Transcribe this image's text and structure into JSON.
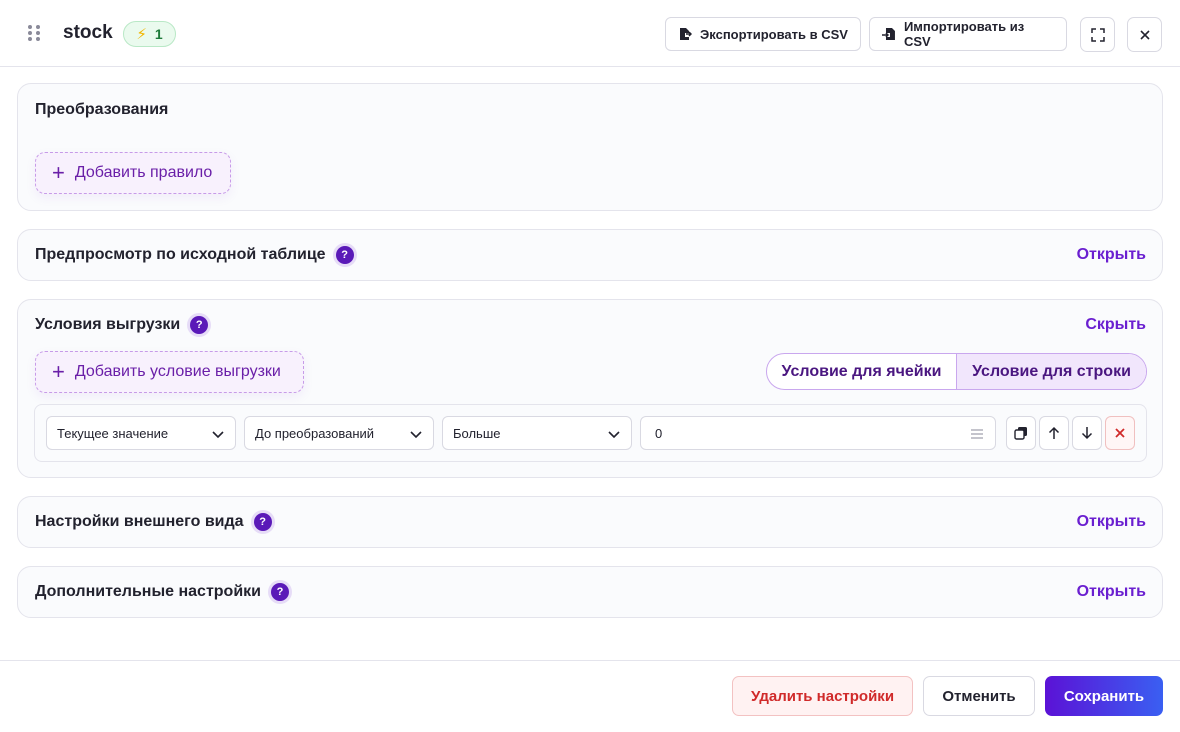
{
  "header": {
    "title": "stock",
    "badge_count": "1",
    "export_label": "Экспортировать в CSV",
    "import_label": "Импортировать из CSV"
  },
  "transformations": {
    "title": "Преобразования",
    "add_rule_label": "Добавить правило"
  },
  "preview": {
    "title": "Предпросмотр по исходной таблице",
    "link": "Открыть"
  },
  "export_conditions": {
    "title": "Условия выгрузки",
    "link": "Скрыть",
    "add_condition_label": "Добавить условие выгрузки",
    "segments": [
      "Условие для ячейки",
      "Условие для строки"
    ],
    "selected_segment": "Условие для строки",
    "row": {
      "select_value": "Текущее значение",
      "select_stage": "До преобразований",
      "select_operator": "Больше",
      "value": "0"
    }
  },
  "appearance": {
    "title": "Настройки внешнего вида",
    "link": "Открыть"
  },
  "additional": {
    "title": "Дополнительные настройки",
    "link": "Открыть"
  },
  "footer": {
    "delete_label": "Удалить настройки",
    "cancel_label": "Отменить",
    "save_label": "Сохранить"
  },
  "colors": {
    "accent": "#6a1fd0",
    "danger": "#d02a2a",
    "badge_green": "#1f7a3a"
  },
  "icons": {
    "help": "?",
    "plus": "+",
    "bolt": "⚡"
  }
}
